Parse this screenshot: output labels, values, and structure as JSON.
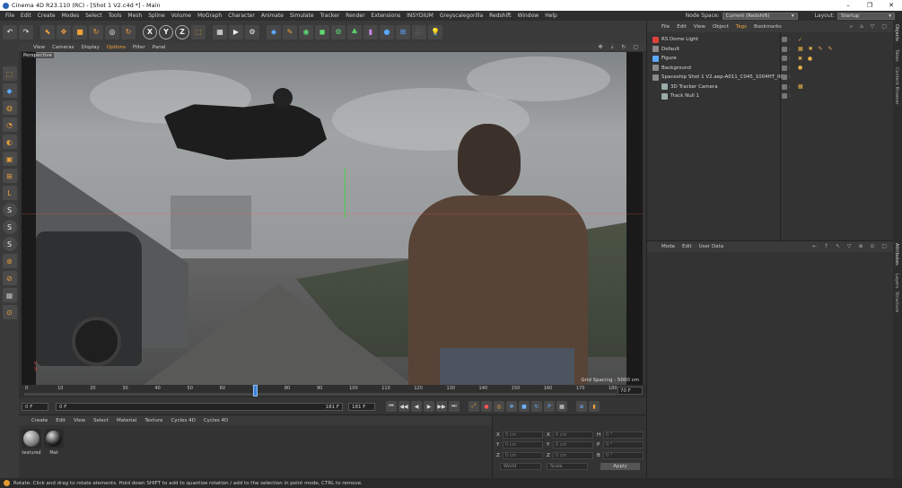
{
  "window": {
    "title": "Cinema 4D R23.110 (RC) - [Shot 1 V2.c4d *] - Main",
    "controls": [
      "–",
      "❐",
      "✕"
    ]
  },
  "menubar": {
    "items": [
      "File",
      "Edit",
      "Create",
      "Modes",
      "Select",
      "Tools",
      "Mesh",
      "Spline",
      "Volume",
      "MoGraph",
      "Character",
      "Animate",
      "Simulate",
      "Tracker",
      "Render",
      "Extensions",
      "INSYDIUM",
      "Greyscalegorilla",
      "Redshift",
      "Window",
      "Help"
    ],
    "node_space_label": "Node Space:",
    "node_space_value": "Current (Redshift)",
    "layout_label": "Layout:",
    "layout_value": "Startup"
  },
  "toolbar": {
    "buttons": [
      "↶",
      "↷",
      "⬉",
      "✥",
      "■",
      "↻",
      "◎",
      "↻"
    ],
    "axes": [
      "X",
      "Y",
      "Z"
    ],
    "render_buttons": [
      "▦",
      "▶",
      "⚙"
    ],
    "object_buttons": [
      "◆",
      "✎",
      "◉",
      "◼",
      "⚙",
      "♣",
      "▮",
      "●",
      "⊞",
      "🎥",
      "💡"
    ]
  },
  "left_tools": [
    "⬚",
    "◆",
    "◍",
    "◔",
    "◐",
    "▣",
    "⊞",
    "L",
    "S",
    "S",
    "S",
    "⊛",
    "⊘",
    "▦",
    "⊙"
  ],
  "viewport": {
    "menu": [
      "View",
      "Cameras",
      "Display",
      "Options",
      "Filter",
      "Panel"
    ],
    "controls": "✥ ⇣ ↻ ▢",
    "label": "Perspective",
    "grid_spacing": "Grid Spacing : 5000 cm",
    "axis_label": "Y\nX"
  },
  "timeline": {
    "ticks": [
      "0",
      "10",
      "20",
      "30",
      "40",
      "50",
      "60",
      "70",
      "80",
      "90",
      "100",
      "110",
      "120",
      "130",
      "140",
      "150",
      "160",
      "170",
      "180"
    ],
    "current_frame": 70,
    "total_frames": 180,
    "end_frame_field": "70 F"
  },
  "transport": {
    "start_field": "0 F",
    "current_field": "0 F",
    "end_field": "181 F",
    "end_field2": "181 F",
    "buttons": [
      "⏮",
      "◀◀",
      "◀",
      "▶",
      "▶▶",
      "⏭"
    ],
    "key_buttons": [
      "⤢",
      "●",
      "◎",
      "✥",
      "■",
      "↻",
      "P",
      "▦",
      "⊕",
      "▮"
    ]
  },
  "material_manager": {
    "menu": [
      "Create",
      "Edit",
      "View",
      "Select",
      "Material",
      "Texture",
      "Cycles 4D",
      "Cycles 4D"
    ],
    "materials": [
      {
        "name": "textured",
        "color": "#7d7d7d"
      },
      {
        "name": "Mat",
        "color": "#1c1c1c"
      }
    ]
  },
  "coordinates": {
    "rows": [
      {
        "a": "X",
        "av": "0 cm",
        "b": "X",
        "bv": "0 cm",
        "c": "H",
        "cv": "0 °"
      },
      {
        "a": "Y",
        "av": "0 cm",
        "b": "Y",
        "bv": "0 cm",
        "c": "P",
        "cv": "0 °"
      },
      {
        "a": "Z",
        "av": "0 cm",
        "b": "Z",
        "bv": "0 cm",
        "c": "B",
        "cv": "0 °"
      }
    ],
    "mode_world": "World",
    "mode_scale": "Scale",
    "apply_label": "Apply"
  },
  "object_manager": {
    "menu": [
      "File",
      "Edit",
      "View",
      "Object",
      "Tags",
      "Bookmarks"
    ],
    "active_menu": "Tags",
    "toolbar_icons": "⌕ ⌂ ▽ ▢",
    "objects": [
      {
        "name": "RS Dome Light",
        "indent": 0,
        "icon_color": "#e0403a",
        "tags": "✓"
      },
      {
        "name": "Default",
        "indent": 0,
        "icon_color": "#8a8a8a",
        "tags": "▦ ✖ ✎ ✎"
      },
      {
        "name": "Figure",
        "indent": 0,
        "icon_color": "#5aa8ff",
        "tags": "✖ ●"
      },
      {
        "name": "Background",
        "indent": 0,
        "icon_color": "#8a8a8a",
        "tags": "●"
      },
      {
        "name": "Spaceship Shot 1 V2.aep-A011_C045_1004HT_001",
        "indent": 0,
        "icon_color": "#8a8a8a",
        "tags": ""
      },
      {
        "name": "3D Tracker Camera",
        "indent": 1,
        "icon_color": "#9aa",
        "tags": "▦"
      },
      {
        "name": "Track Null 1",
        "indent": 1,
        "icon_color": "#9aa",
        "tags": ""
      }
    ]
  },
  "attribute_manager": {
    "menu": [
      "Mode",
      "Edit",
      "User Data"
    ],
    "toolbar_icons": "← ↑ ↖ ▽ ⊕ ⊙ ▢"
  },
  "right_edge": {
    "top_tabs": [
      "Objects",
      "Takes",
      "Content Browser"
    ],
    "bottom_tabs": [
      "Attributes",
      "Layers",
      "Structure"
    ]
  },
  "statusbar": {
    "text": "Rotate: Click and drag to rotate elements. Hold down SHIFT to add to quantize rotation / add to the selection in point mode, CTRL to remove."
  }
}
